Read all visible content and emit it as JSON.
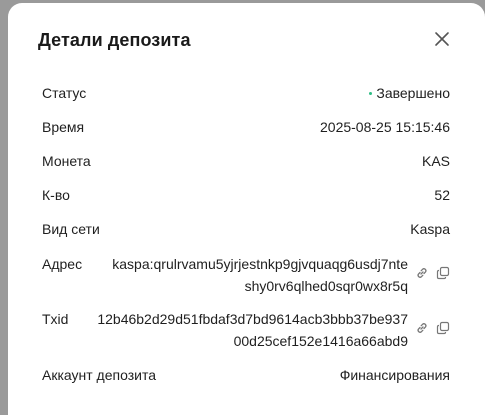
{
  "dialog": {
    "title": "Детали депозита"
  },
  "rows": {
    "status": {
      "label": "Статус",
      "value": "Завершено",
      "status_color": "#2ebd85"
    },
    "time": {
      "label": "Время",
      "value": "2025-08-25 15:15:46"
    },
    "coin": {
      "label": "Монета",
      "value": "KAS"
    },
    "amount": {
      "label": "К-во",
      "value": "52"
    },
    "network": {
      "label": "Вид сети",
      "value": "Kaspa"
    },
    "address": {
      "label": "Адрес",
      "line1": "kaspa:qrulrvamu5yjrjestnkp9gjvquaqg6usdj7nte",
      "line2": "shy0rv6qlhed0sqr0wx8r5q"
    },
    "txid": {
      "label": "Txid",
      "line1": "12b46b2d29d51fbdaf3d7bd9614acb3bbb37be937",
      "line2": "00d25cef152e1416a66abd9"
    },
    "account": {
      "label": "Аккаунт депозита",
      "value": "Финансирования"
    }
  },
  "icons": {
    "close": "close-icon",
    "link": "link-icon",
    "copy": "copy-icon"
  }
}
